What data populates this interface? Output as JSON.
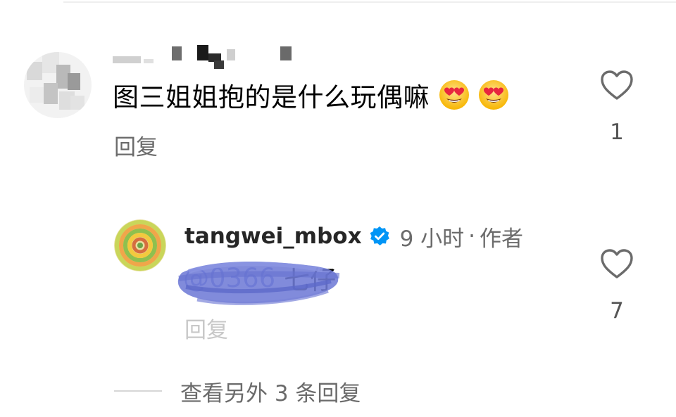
{
  "comment": {
    "text": "图三姐姐抱的是什么玩偶嘛",
    "emojis": [
      "heart-eyes-emoji",
      "heart-eyes-emoji"
    ],
    "reply_label": "回复",
    "like_count": "1"
  },
  "reply": {
    "username": "tangwei_mbox",
    "verified": true,
    "time": "9 小时",
    "separator": "·",
    "author_tag": "作者",
    "mention": "@0366",
    "text": "七仔",
    "reply_label": "回复",
    "like_count": "7"
  },
  "view_more": {
    "label": "查看另外 3 条回复"
  },
  "icons": {
    "like": "heart-outline-icon",
    "verified": "verified-badge-icon"
  },
  "colors": {
    "background": "#ffffff",
    "secondary_text": "#6b6b6b",
    "verified_blue": "#0095f6",
    "scribble": "#6f7bd6"
  }
}
